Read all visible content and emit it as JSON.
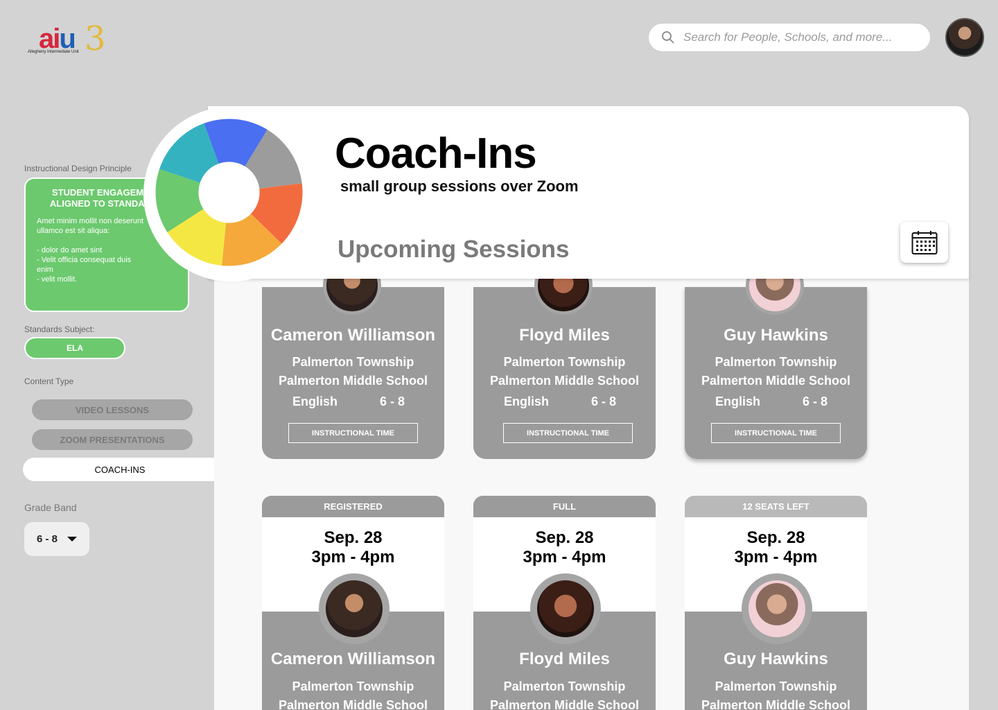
{
  "brand": {
    "logo_text": "aiu",
    "logo_number": "3",
    "logo_subtitle": "Allegheny Intermediate Unit"
  },
  "search": {
    "placeholder": "Search for People, Schools, and more..."
  },
  "sidebar": {
    "principle_label": "Instructional Design Principle",
    "principle_title": "STUDENT ENGAGEMENT ALIGNED TO STANDARDS",
    "principle_body": "Amet minim mollit non deserunt ullamco est sit aliqua:\n\n- dolor do amet sint\n- Velit officia consequat duis enim\n- velit mollit.",
    "standards_label": "Standards Subject:",
    "standards_value": "ELA",
    "content_label": "Content Type",
    "content_types": [
      "VIDEO LESSONS",
      "ZOOM PRESENTATIONS",
      "COACH-INS"
    ],
    "grade_label": "Grade Band",
    "grade_value": "6 - 8"
  },
  "header": {
    "title": "Coach-Ins",
    "subtitle": "small group sessions over Zoom",
    "section": "Upcoming Sessions"
  },
  "wheel_colors": [
    "#4a6ff0",
    "#9c9c9c",
    "#f26b3f",
    "#f6a93b",
    "#f5e743",
    "#6cc96e",
    "#35b2c0"
  ],
  "sessions_top": [
    {
      "name": "Cameron Williamson",
      "district": "Palmerton Township",
      "school": "Palmerton Middle School",
      "subject": "English",
      "grades": "6 - 8",
      "tag": "INSTRUCTIONAL TIME"
    },
    {
      "name": "Floyd Miles",
      "district": "Palmerton Township",
      "school": "Palmerton Middle School",
      "subject": "English",
      "grades": "6 - 8",
      "tag": "INSTRUCTIONAL TIME"
    },
    {
      "name": "Guy Hawkins",
      "district": "Palmerton Township",
      "school": "Palmerton Middle School",
      "subject": "English",
      "grades": "6 - 8",
      "tag": "INSTRUCTIONAL TIME"
    }
  ],
  "sessions_bottom": [
    {
      "status": "REGISTERED",
      "date": "Sep. 28",
      "time": "3pm - 4pm",
      "name": "Cameron Williamson",
      "district": "Palmerton Township",
      "school": "Palmerton Middle School"
    },
    {
      "status": "FULL",
      "date": "Sep. 28",
      "time": "3pm - 4pm",
      "name": "Floyd Miles",
      "district": "Palmerton Township",
      "school": "Palmerton Middle School"
    },
    {
      "status": "12 SEATS LEFT",
      "date": "Sep. 28",
      "time": "3pm - 4pm",
      "name": "Guy Hawkins",
      "district": "Palmerton Township",
      "school": "Palmerton Middle School"
    }
  ]
}
